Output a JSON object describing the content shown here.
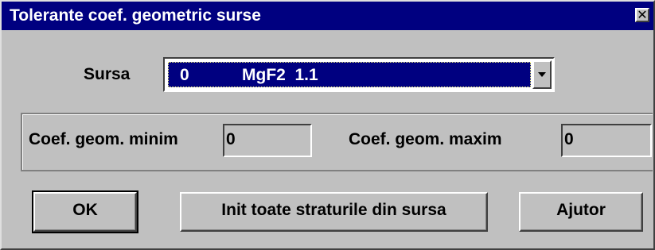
{
  "window": {
    "title": "Tolerante coef. geometric surse",
    "close_glyph": "✕"
  },
  "source": {
    "label": "Sursa",
    "selected_index": "0",
    "selected_text": "MgF2  1.1",
    "arrow_icon": "chevron-down-icon"
  },
  "coefficients": {
    "min_label": "Coef. geom. minim",
    "min_value": "0",
    "max_label": "Coef. geom. maxim",
    "max_value": "0"
  },
  "buttons": {
    "ok": "OK",
    "init_all": "Init toate straturile din sursa",
    "help": "Ajutor"
  },
  "colors": {
    "titlebar": "#000080",
    "face": "#c0c0c0",
    "selection": "#000080"
  }
}
